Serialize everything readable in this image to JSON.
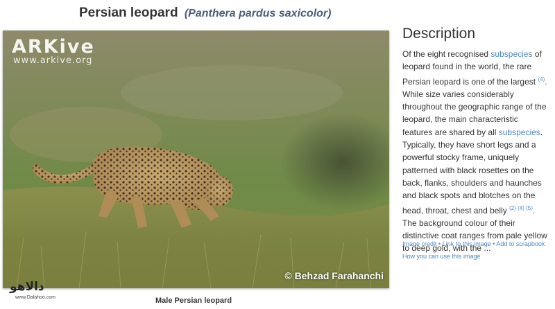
{
  "header": {
    "common_name": "Persian leopard",
    "scientific_name": "(Panthera pardus saxicolor)"
  },
  "photo": {
    "watermark_logo": "ARKive",
    "watermark_url": "www.arkive.org",
    "photographer_credit": "© Behzad Farahanchi",
    "caption": "Male Persian leopard"
  },
  "site_logo": {
    "text": "دالاهو",
    "url": "www.Dalahoo.com"
  },
  "description": {
    "heading": "Description",
    "p1": "Of the eight recognised ",
    "link_subspecies_1": "subspecies",
    "p2": " of leopard found in the world, the rare Persian leopard is one of the largest ",
    "ref_1": "(4)",
    "p3": ". While size varies considerably throughout the geographic range of the leopard, the main characteristic features are shared by all ",
    "link_subspecies_2": "subspecies",
    "p4": ". Typically, they have short legs and a powerful stocky frame, uniquely patterned with black rosettes on the back, flanks, shoulders and haunches and black spots and blotches on the head, throat, chest and belly ",
    "ref_2": "(2) (4) (5)",
    "p5": ". The background colour of their distinctive coat ranges from pale yellow to deep gold, with the ..."
  },
  "links": {
    "image_credit": "Image credit",
    "link_to_image": "Link to this image",
    "add_to_scrapbook": "Add to scrapbook",
    "how_to_use": "How you can use this image",
    "separator": " • "
  },
  "colors": {
    "link": "#4a86c5",
    "scientific_name": "#4a5d78",
    "text": "#333333"
  }
}
